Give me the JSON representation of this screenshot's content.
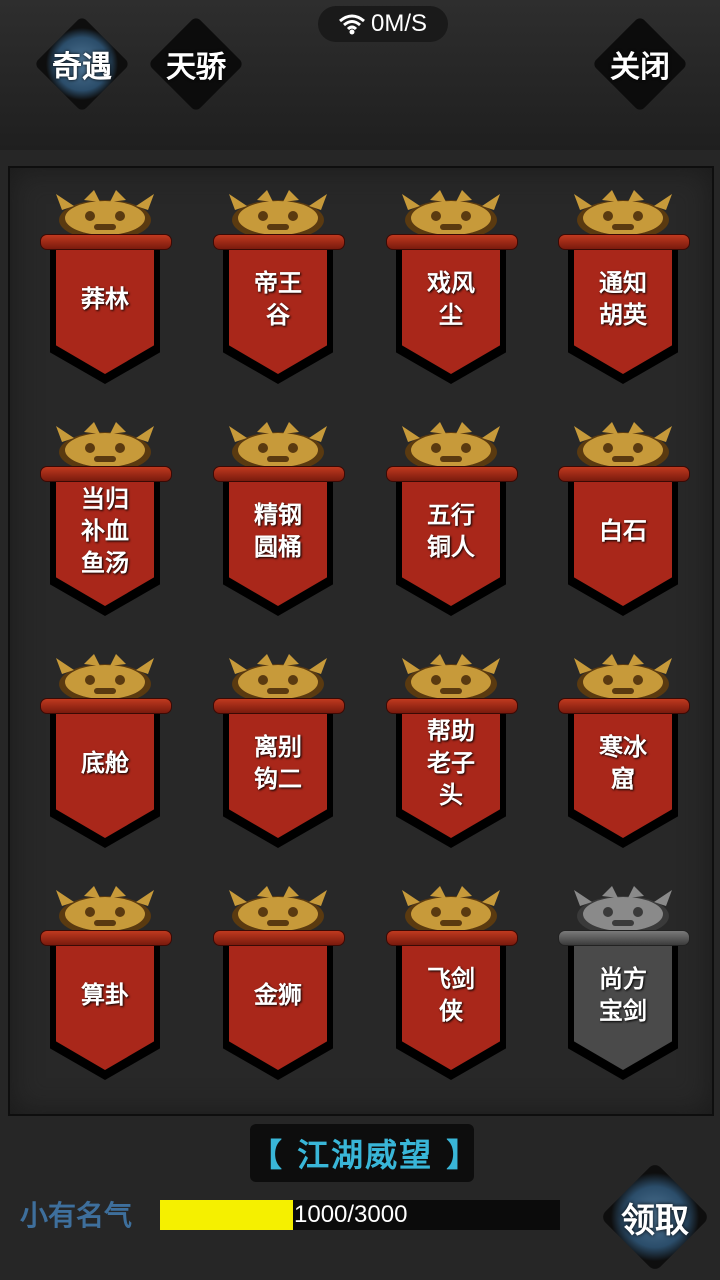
{
  "status": {
    "speed": "0M/S",
    "icon": "wifi-icon"
  },
  "tabs": [
    {
      "label": "奇遇",
      "active": true
    },
    {
      "label": "天骄",
      "active": false
    }
  ],
  "close_label": "关闭",
  "colors": {
    "banner_red": "#a9271a",
    "banner_gray": "#4a4a4a",
    "accent_blue": "#39b6d8",
    "progress_yellow": "#f5f000"
  },
  "encounters": [
    {
      "name": "莽林",
      "locked": false
    },
    {
      "name": "帝王\n谷",
      "locked": false
    },
    {
      "name": "戏风\n尘",
      "locked": false
    },
    {
      "name": "通知\n胡英",
      "locked": false
    },
    {
      "name": "当归\n补血\n鱼汤",
      "locked": false
    },
    {
      "name": "精钢\n圆桶",
      "locked": false
    },
    {
      "name": "五行\n铜人",
      "locked": false
    },
    {
      "name": "白石",
      "locked": false
    },
    {
      "name": "底舱",
      "locked": false
    },
    {
      "name": "离别\n钩二",
      "locked": false
    },
    {
      "name": "帮助\n老子\n头",
      "locked": false
    },
    {
      "name": "寒冰\n窟",
      "locked": false
    },
    {
      "name": "算卦",
      "locked": false
    },
    {
      "name": "金狮",
      "locked": false
    },
    {
      "name": "飞剑\n侠",
      "locked": false
    },
    {
      "name": "尚方\n宝剑",
      "locked": true
    }
  ],
  "reputation": {
    "title": "【 江湖威望 】",
    "rank": "小有名气",
    "progress_text": "1000/3000",
    "progress_fraction": 0.333,
    "claim_label": "领取"
  }
}
